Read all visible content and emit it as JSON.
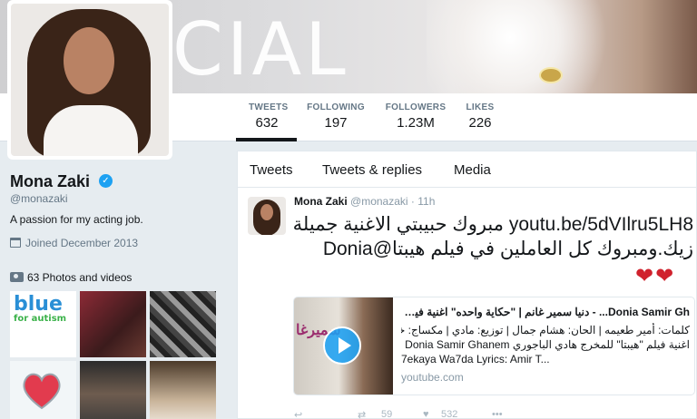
{
  "banner": {
    "word": "CIAL"
  },
  "profile": {
    "name": "Mona Zaki",
    "handle": "@monazaki",
    "bio": "A passion for my acting job.",
    "joined": "Joined December 2013",
    "photos_label": "63 Photos and videos",
    "thumb_text_1": "blue",
    "thumb_text_2": "for autism"
  },
  "stats": [
    {
      "label": "TWEETS",
      "value": "632"
    },
    {
      "label": "FOLLOWING",
      "value": "197"
    },
    {
      "label": "FOLLOWERS",
      "value": "1.23M"
    },
    {
      "label": "LIKES",
      "value": "226"
    }
  ],
  "tabs": [
    "Tweets",
    "Tweets & replies",
    "Media"
  ],
  "tweet": {
    "name": "Mona Zaki",
    "handle": "@monazaki",
    "time": "· 11h",
    "text": "youtu.be/5dVIlru5LH8 مبروك حبيبتي الاغنية جميلة زيك.ومبروك كل العاملين في فيلم هيبتا@Donia",
    "hearts": "❤❤",
    "card": {
      "thumb_text": "سميرغا",
      "title": "Donia Samir Gh... - دنيا سمير غانم | \"حكاية واحده\" اغنية فيلم هيبتا",
      "desc_line1": "كلمات: أمير طعيمه | الحان: هشام جمال | توزيع: مادي | مكساج: خالد سند",
      "desc_line2": "اغنية فيلم \"هيبتا\" للمخرج هادي الباجوري Donia Samir Ghanem |",
      "desc_line3": "7ekaya Wa7da Lyrics: Amir T...",
      "domain": "youtube.com"
    },
    "retweets": "59",
    "likes": "532"
  },
  "colors": {
    "accent": "#1da1f2",
    "heart": "#d0222d"
  }
}
